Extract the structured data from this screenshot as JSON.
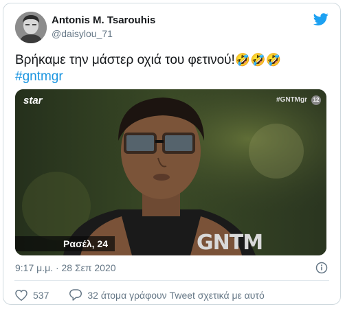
{
  "author": {
    "name": "Antonis M. Tsarouhis",
    "handle": "@daisylou_71"
  },
  "tweet": {
    "text": "Βρήκαμε την μάστερ οχιά του φετινού!",
    "emojis": "🤣🤣🤣",
    "hashtag": "#gntmgr"
  },
  "media": {
    "channel_logo": "star",
    "corner_tag": "#GNTMgr",
    "age_rating": "12",
    "caption": "Ρασέλ, 24",
    "show_logo": "GNTM"
  },
  "meta": {
    "timestamp": "9:17 μ.μ. · 28 Σεπ 2020"
  },
  "actions": {
    "likes": "537",
    "talking": "32 άτομα γράφουν Tweet σχετικά με αυτό"
  },
  "icons": {
    "brand": "twitter-bird-icon",
    "like": "heart-icon",
    "reply": "speech-bubble-icon",
    "info": "info-icon"
  },
  "colors": {
    "twitter_blue": "#1da1f2",
    "hashtag": "#1b95e0",
    "muted": "#657786"
  }
}
